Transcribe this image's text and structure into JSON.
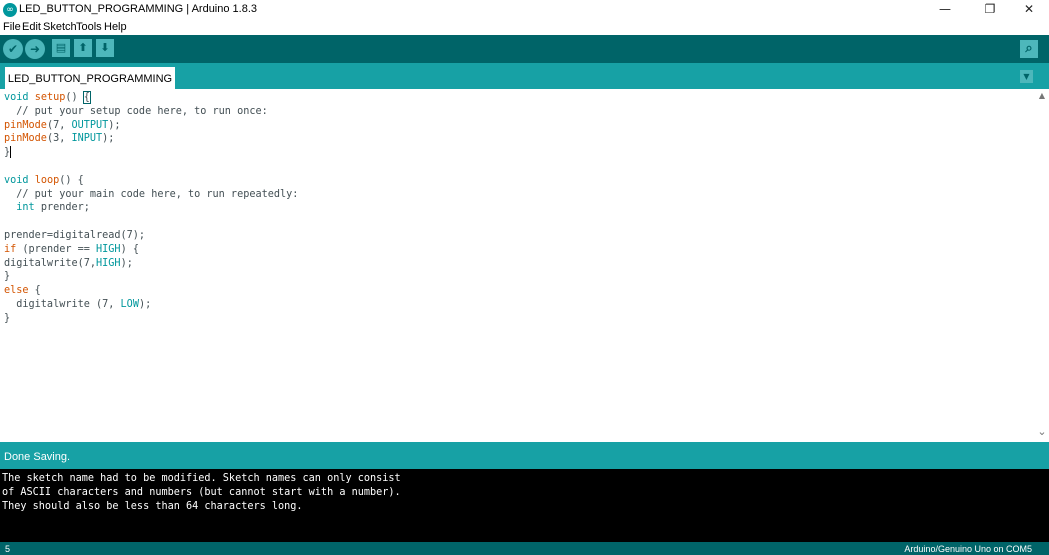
{
  "window": {
    "title": "LED_BUTTON_PROGRAMMING | Arduino 1.8.3",
    "icon": "arduino-logo-icon",
    "minimize_glyph": "—",
    "maximize_glyph": "❐",
    "close_glyph": "✕"
  },
  "menu": [
    "File",
    "Edit",
    "Sketch",
    "Tools",
    "Help"
  ],
  "toolbar": {
    "verify_icon": "check-icon",
    "verify_glyph": "✔",
    "upload_icon": "arrow-right-icon",
    "upload_glyph": "➜",
    "new_icon": "new-file-icon",
    "new_glyph": "▤",
    "open_icon": "arrow-up-icon",
    "open_glyph": "⬆",
    "save_icon": "arrow-down-icon",
    "save_glyph": "⬇",
    "serial_monitor_icon": "magnifier-icon",
    "serial_monitor_glyph": "⌕"
  },
  "tabs": [
    {
      "label": "LED_BUTTON_PROGRAMMING",
      "active": true
    }
  ],
  "tab_menu_glyph": "▼",
  "editor": {
    "code_lines": [
      "void setup() {",
      "  // put your setup code here, to run once:",
      "pinMode(7, OUTPUT);",
      "pinMode(3, INPUT);",
      "}",
      "",
      "void loop() {",
      "  // put your main code here, to run repeatedly:",
      "  int prender;",
      "",
      "prender=digitalread(7);",
      "if (prender == HIGH) {",
      "digitalwrite(7,HIGH);",
      "}",
      "else {",
      "  digitalwrite (7, LOW);",
      "}"
    ],
    "scroll_up_glyph": "▲",
    "scroll_down_glyph": "⌄"
  },
  "status": {
    "message": "Done Saving."
  },
  "console": {
    "lines": [
      "The sketch name had to be modified. Sketch names can only consist",
      "of ASCII characters and numbers (but cannot start with a number).",
      "They should also be less than 64 characters long."
    ]
  },
  "footer": {
    "line_number": "5",
    "board": "Arduino/Genuino Uno on COM5"
  },
  "colors": {
    "toolbar_bg": "#006468",
    "tabstrip_bg": "#17a1a5",
    "button_fill": "#4db7bb",
    "keyword": "#00979c",
    "function": "#d35400",
    "console_bg": "#000000"
  }
}
